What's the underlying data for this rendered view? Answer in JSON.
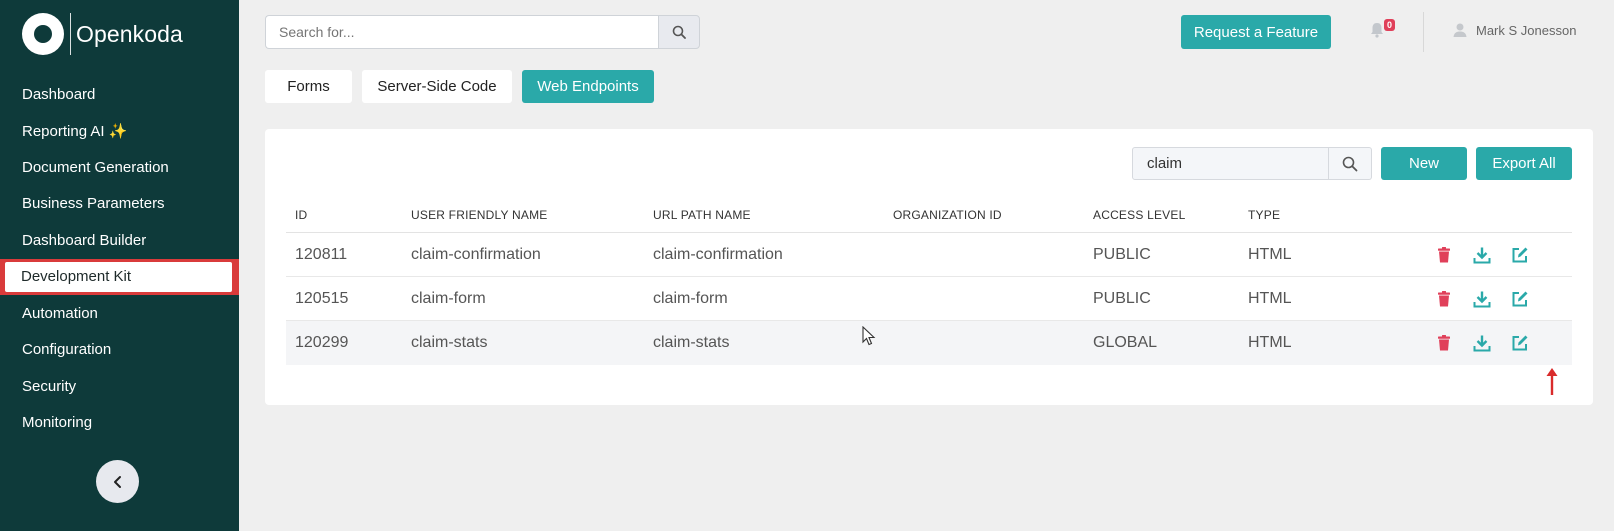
{
  "app": {
    "name": "Openkoda"
  },
  "sidebar": {
    "items": [
      {
        "label": "Dashboard"
      },
      {
        "label": "Reporting AI ✨"
      },
      {
        "label": "Document Generation"
      },
      {
        "label": "Business Parameters"
      },
      {
        "label": "Dashboard Builder"
      },
      {
        "label": "Development Kit",
        "active": true
      },
      {
        "label": "Automation"
      },
      {
        "label": "Configuration"
      },
      {
        "label": "Security"
      },
      {
        "label": "Monitoring"
      }
    ],
    "collapse_icon": "chevron-left-icon"
  },
  "header": {
    "search": {
      "placeholder": "Search for..."
    },
    "request_feature_label": "Request a Feature",
    "notifications_count": "0",
    "user_name": "Mark S Jonesson"
  },
  "tabs": [
    {
      "label": "Forms",
      "active": false
    },
    {
      "label": "Server-Side Code",
      "active": false
    },
    {
      "label": "Web Endpoints",
      "active": true
    }
  ],
  "table_toolbar": {
    "search_value": "claim",
    "new_label": "New",
    "export_label": "Export All"
  },
  "table": {
    "columns": [
      "ID",
      "USER FRIENDLY NAME",
      "URL PATH NAME",
      "ORGANIZATION ID",
      "ACCESS LEVEL",
      "TYPE"
    ],
    "rows": [
      {
        "id": "120811",
        "name": "claim-confirmation",
        "path": "claim-confirmation",
        "org": "",
        "access": "PUBLIC",
        "type": "HTML"
      },
      {
        "id": "120515",
        "name": "claim-form",
        "path": "claim-form",
        "org": "",
        "access": "PUBLIC",
        "type": "HTML"
      },
      {
        "id": "120299",
        "name": "claim-stats",
        "path": "claim-stats",
        "org": "",
        "access": "GLOBAL",
        "type": "HTML"
      }
    ]
  },
  "colors": {
    "sidebar_bg": "#0e3a3a",
    "accent": "#2aa9a9",
    "delete": "#e0405a",
    "highlight": "#d93b3b"
  }
}
